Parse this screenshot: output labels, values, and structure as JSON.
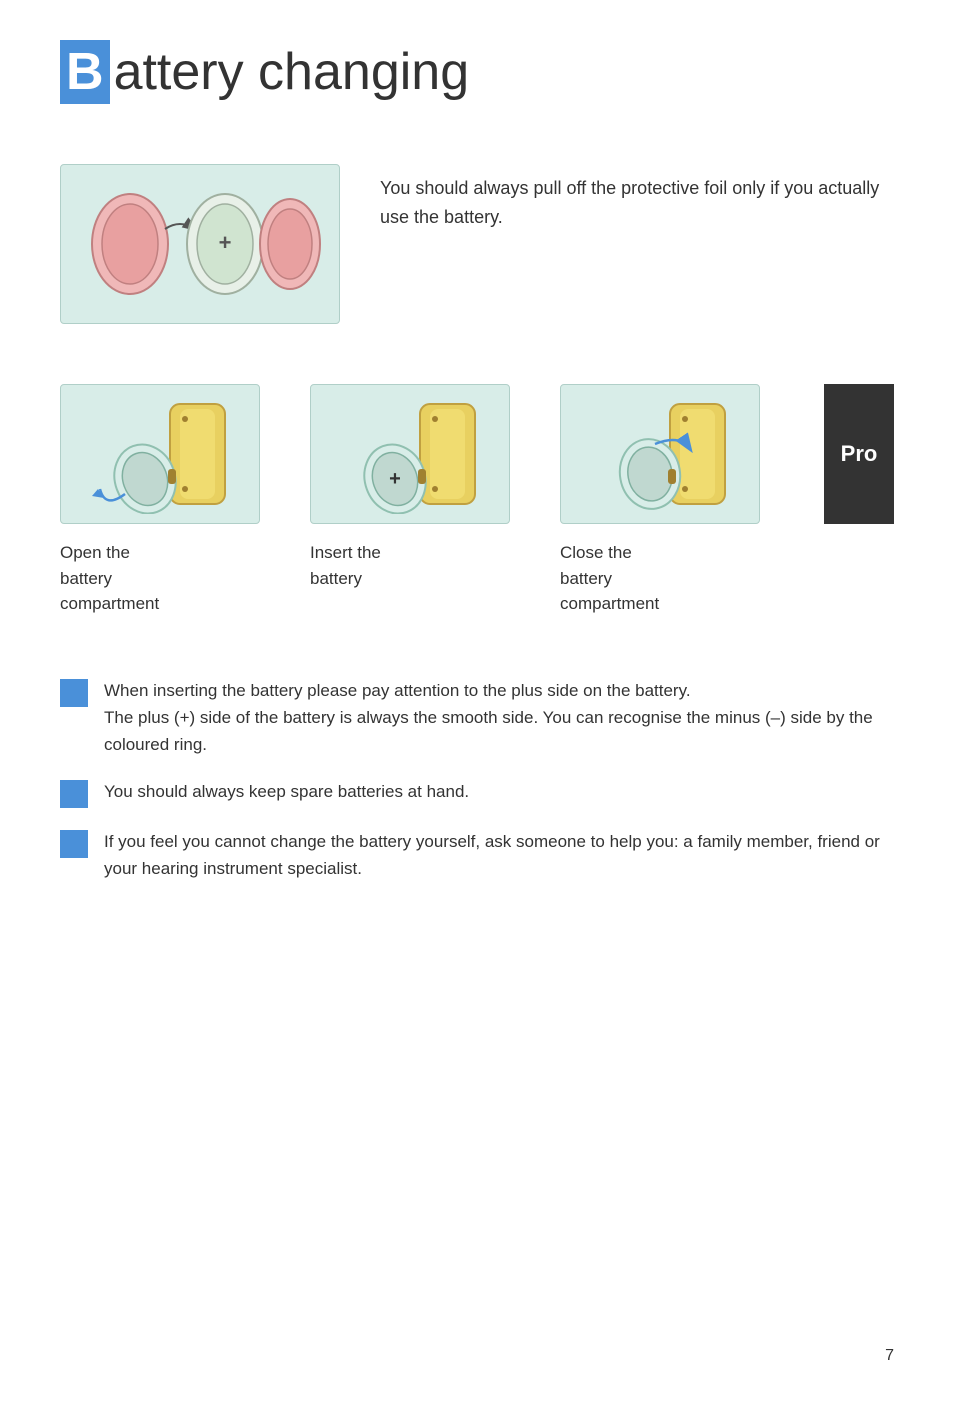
{
  "title": {
    "highlight": "B",
    "full_word": "Battery",
    "rest": " changing"
  },
  "intro": {
    "text": "You should always pull off the protective foil only if you actually use the battery."
  },
  "steps": [
    {
      "label_line1": "Open the",
      "label_line2": "battery",
      "label_line3": "compartment"
    },
    {
      "label_line1": "Insert the",
      "label_line2": "battery",
      "label_line3": ""
    },
    {
      "label_line1": "Close the",
      "label_line2": "battery",
      "label_line3": "compartment"
    }
  ],
  "pro_badge": "Pro",
  "notes": [
    {
      "text": "When inserting the battery please pay attention to the plus side on the battery.\nThe plus (+) side of the battery is always the smooth side. You can recognise the minus (–) side by the coloured ring."
    },
    {
      "text": "You should always keep spare batteries at hand."
    },
    {
      "text": "If you feel you cannot change the battery yourself, ask someone to help you: a family member, friend or your hearing instrument specialist."
    }
  ],
  "page_number": "7",
  "colors": {
    "accent_blue": "#4a90d9",
    "bg_light_teal": "#d8ede8",
    "border_teal": "#b0cfc8",
    "dark": "#333333",
    "white": "#ffffff"
  }
}
